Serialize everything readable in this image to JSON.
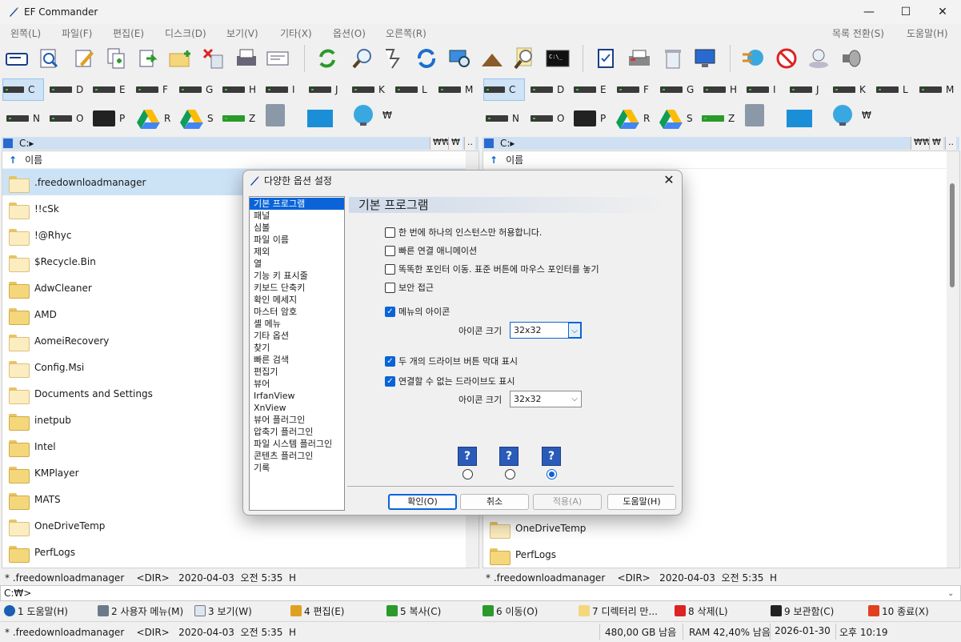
{
  "window": {
    "title": "EF Commander",
    "minimize": "—",
    "maximize": "☐",
    "close": "✕"
  },
  "menu": {
    "left": [
      "왼쪽(L)",
      "파일(F)",
      "편집(E)",
      "디스크(D)",
      "보기(V)",
      "기타(X)",
      "옵션(O)",
      "오른쪽(R)"
    ],
    "right": [
      "목록 전환(S)",
      "도움말(H)"
    ]
  },
  "toolbar": {
    "icons": [
      "drive-icon",
      "view-icon",
      "edit-icon",
      "copy-icon",
      "move-icon",
      "new-folder-icon",
      "delete-icon",
      "print-icon",
      "email-icon",
      "sync-icon",
      "search-icon",
      "compare-icon",
      "refresh-icon",
      "network-icon",
      "tree-icon",
      "find-icon",
      "terminal-icon",
      "checklist-icon",
      "printer-icon",
      "recycle-icon",
      "monitor-icon",
      "ftp-icon",
      "disconnect-icon",
      "usb-icon",
      "media-icon"
    ]
  },
  "drives": {
    "row1": [
      "C",
      "D",
      "E",
      "F",
      "G",
      "H",
      "I",
      "J",
      "K",
      "L",
      "M"
    ],
    "row2": [
      "N",
      "O",
      "P",
      "R",
      "S",
      "Z",
      "",
      "",
      "₩"
    ]
  },
  "left_panel": {
    "path": "C:",
    "tag1": "₩₩",
    "tag2": "₩",
    "tag3": "..",
    "column_name": "이름",
    "rows": [
      ".freedownloadmanager",
      "!!cSk",
      "!@Rhyc",
      "$Recycle.Bin",
      "AdwCleaner",
      "AMD",
      "AomeiRecovery",
      "Config.Msi",
      "Documents and Settings",
      "inetpub",
      "Intel",
      "KMPlayer",
      "MATS",
      "OneDriveTemp",
      "PerfLogs"
    ]
  },
  "right_panel": {
    "path": "C:",
    "tag1": "₩₩",
    "tag2": "₩",
    "tag3": "..",
    "column_name": "이름",
    "rows": [
      "OneDriveTemp",
      "PerfLogs"
    ]
  },
  "status": {
    "left": "* .freedownloadmanager    <DIR>   2020-04-03  오전 5:35  H",
    "right": "* .freedownloadmanager    <DIR>   2020-04-03  오전 5:35  H"
  },
  "cmdline": "C:₩>",
  "fkeys": [
    "1 도움말(H)",
    "2 사용자 메뉴(M)",
    "3 보기(W)",
    "4 편집(E)",
    "5 복사(C)",
    "6 이동(O)",
    "7 디렉터리 만...",
    "8 삭제(L)",
    "9 보관함(C)",
    "10 종료(X)"
  ],
  "bottom": {
    "file": "* .freedownloadmanager    <DIR>   2020-04-03  오전 5:35  H",
    "free": "480,00 GB 남음",
    "ram": "RAM 42,40% 남음",
    "date": "2026-01-30",
    "time": "오후 10:19"
  },
  "dialog": {
    "title": "다양한 옵션 설정",
    "categories": [
      "기본 프로그램",
      "패널",
      "심볼",
      "파일 이름",
      "제외",
      "열",
      "기능 키 표시줄",
      "키보드 단축키",
      "확인 메세지",
      "마스터 암호",
      "셸 메뉴",
      "기타 옵션",
      "찾기",
      "빠른 검색",
      "편집기",
      "뷰어",
      "IrfanView",
      "XnView",
      "뷰어 플러그인",
      "압축기 플러그인",
      "파일 시스템 플러그인",
      "콘텐츠 플러그인",
      "기록"
    ],
    "section_title": "기본 프로그램",
    "options": {
      "single_instance": "한 번에 하나의 인스턴스만 허용합니다.",
      "fast_animation": "빠른 연결 애니메이션",
      "smart_pointer": "똑똑한 포인터 이동. 표준 버튼에 마우스 포인터를 놓기",
      "secure_access": "보안 접근",
      "menu_icons": "메뉴의 아이콘",
      "icon_size_label": "아이콘 크기",
      "icon_size_value": "32x32",
      "two_drive_bars": "두 개의 드라이브 버튼 막대 표시",
      "show_unconnectable": "연결할 수 없는 드라이브도 표시",
      "icon_size_label2": "아이콘 크기",
      "icon_size_value2": "32x32"
    },
    "buttons": {
      "ok": "확인(O)",
      "cancel": "취소",
      "apply": "적용(A)",
      "help": "도움말(H)"
    }
  }
}
